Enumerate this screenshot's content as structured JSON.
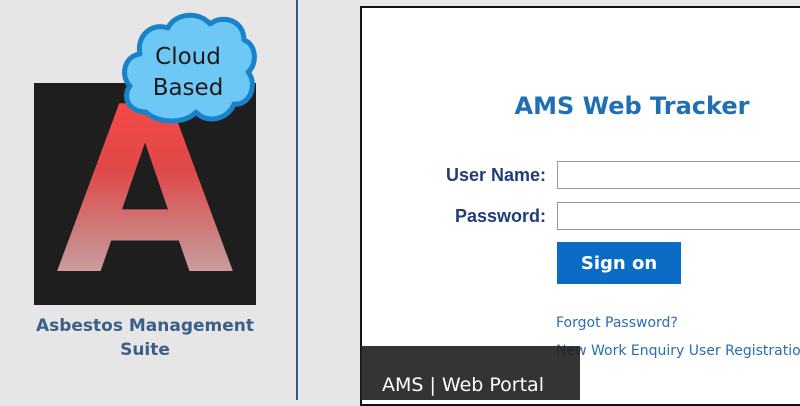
{
  "branding": {
    "logo_letter": "A",
    "cloud_line1": "Cloud",
    "cloud_line2": "Based",
    "suite_title_line1": "Asbestos Management",
    "suite_title_line2": "Suite"
  },
  "login": {
    "title": "AMS Web Tracker",
    "username_label": "User Name:",
    "username_value": "",
    "password_label": "Password:",
    "password_value": "",
    "signon_label": "Sign on",
    "forgot_link": "Forgot Password?",
    "new_user_link": "New Work Enquiry User Registration"
  },
  "caption": {
    "text": "AMS | Web Portal"
  },
  "colors": {
    "accent": "#1f6fb5",
    "button": "#0b6cc5",
    "divider": "#2e5a8a",
    "cloud_fill": "#6ec8f5",
    "cloud_stroke": "#1a82c9"
  }
}
